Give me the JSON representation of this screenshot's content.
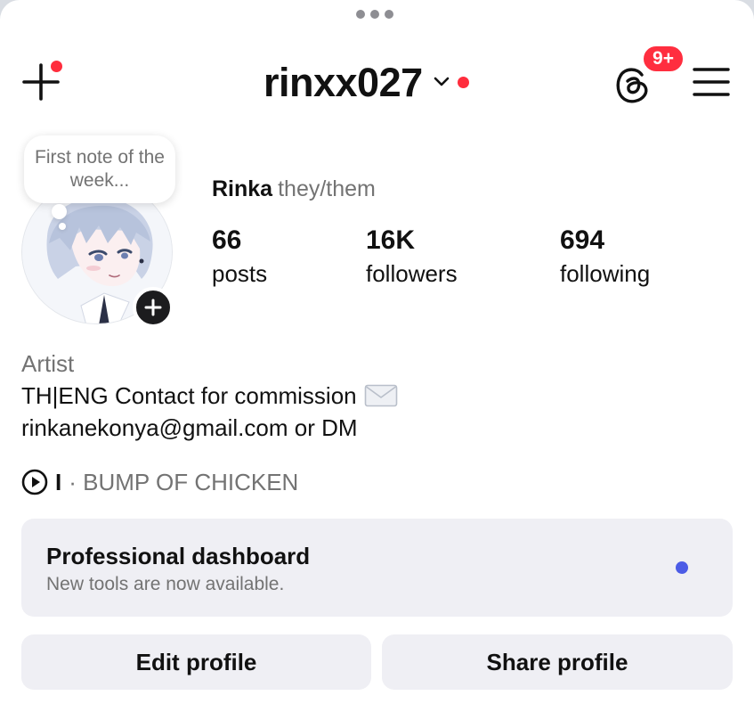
{
  "colors": {
    "notification_red": "#ff2d3d",
    "secondary_text": "#737373",
    "button_bg": "#efeff4",
    "dashboard_dot": "#4c5ce6"
  },
  "header": {
    "username": "rinxx027",
    "threads_badge": "9+",
    "icons": [
      "create-icon",
      "chevron-down-icon",
      "threads-icon",
      "menu-icon"
    ]
  },
  "note": {
    "text": "First note of the week..."
  },
  "profile": {
    "display_name": "Rinka",
    "pronouns": "they/them"
  },
  "stats": [
    {
      "value": "66",
      "label": "posts"
    },
    {
      "value": "16K",
      "label": "followers"
    },
    {
      "value": "694",
      "label": "following"
    }
  ],
  "bio": {
    "category": "Artist",
    "line1": "TH|ENG Contact for commission",
    "line2": "rinkanekonya@gmail.com or DM"
  },
  "music": {
    "title": "I",
    "artist": "· BUMP OF CHICKEN"
  },
  "dashboard": {
    "title": "Professional dashboard",
    "subtitle": "New tools are now available."
  },
  "actions": {
    "edit_profile": "Edit profile",
    "share_profile": "Share profile"
  }
}
